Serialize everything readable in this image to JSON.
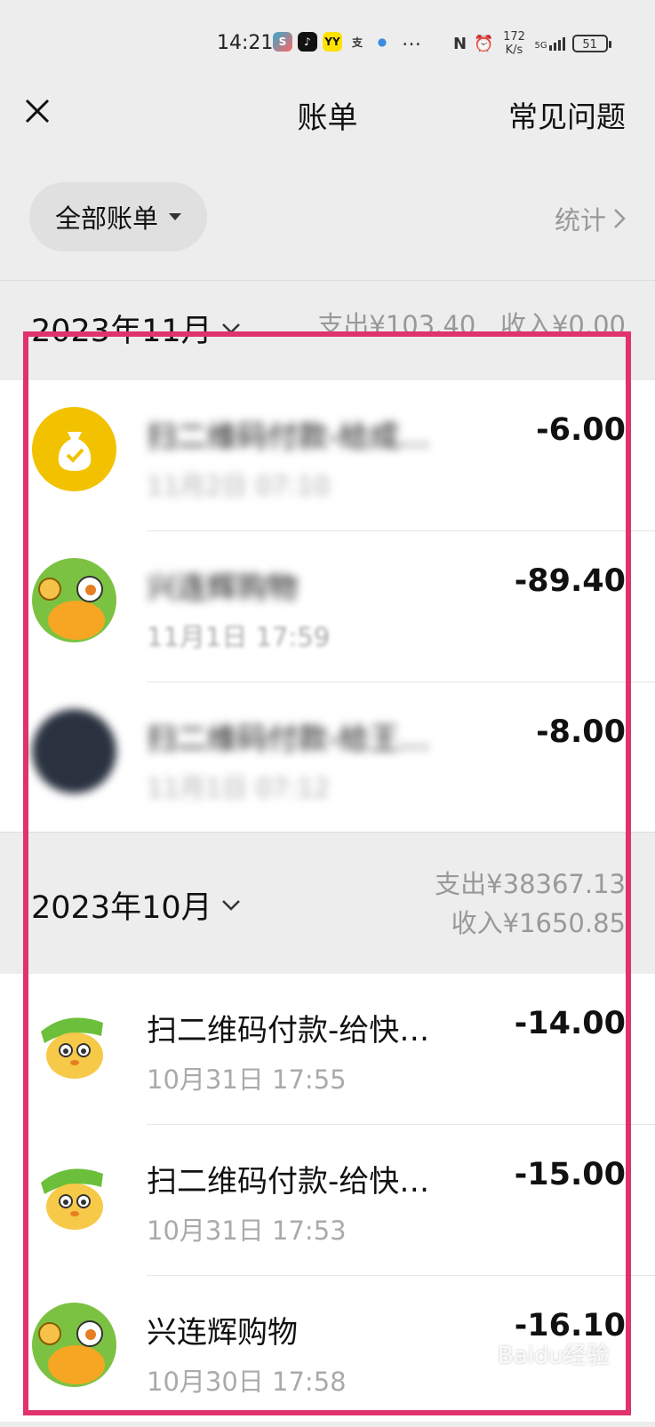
{
  "status_bar": {
    "time": "14:21",
    "apps": [
      "S",
      "♪",
      "YY",
      "支",
      "●"
    ],
    "more": "…",
    "network_speed": "172 K/s",
    "signal": "5G",
    "battery": "51"
  },
  "nav": {
    "title": "账单",
    "faq": "常见问题"
  },
  "filter": {
    "label": "全部账单",
    "stats": "统计"
  },
  "months": [
    {
      "title": "2023年11月",
      "expense": "支出¥103.40",
      "income": "收入¥0.00",
      "items": [
        {
          "title": "扫二维码付款-给成…",
          "time": "11月2日 07:10",
          "amount": "-6.00"
        },
        {
          "title": "兴连辉购物",
          "time": "11月1日 17:59",
          "amount": "-89.40"
        },
        {
          "title": "扫二维码付款-给王…",
          "time": "11月1日 07:12",
          "amount": "-8.00"
        }
      ]
    },
    {
      "title": "2023年10月",
      "expense": "支出¥38367.13",
      "income": "收入¥1650.85",
      "items": [
        {
          "title": "扫二维码付款-给快…",
          "time": "10月31日 17:55",
          "amount": "-14.00"
        },
        {
          "title": "扫二维码付款-给快…",
          "time": "10月31日 17:53",
          "amount": "-15.00"
        },
        {
          "title": "兴连辉购物",
          "time": "10月30日 17:58",
          "amount": "-16.10"
        }
      ]
    }
  ],
  "watermark": "Baidu经验",
  "colors": {
    "highlight": "#e0336b",
    "background": "#ededed",
    "coin_icon": "#f2c200",
    "avatar_green": "#7cc242"
  }
}
